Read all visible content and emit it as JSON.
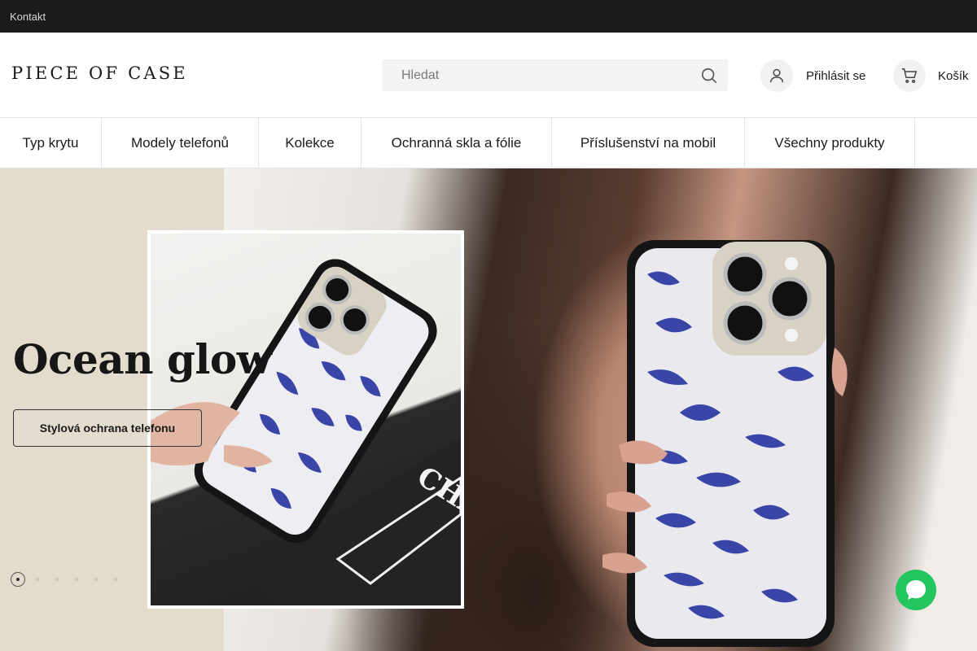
{
  "topbar": {
    "contact_link": "Kontakt"
  },
  "header": {
    "logo_text": "PIECE OF CASE",
    "search": {
      "placeholder": "Hledat",
      "value": ""
    },
    "login_label": "Přihlásit se",
    "cart_label": "Košík"
  },
  "nav": {
    "items": [
      {
        "label": "Typ krytu"
      },
      {
        "label": "Modely telefonů"
      },
      {
        "label": "Kolekce"
      },
      {
        "label": "Ochranná skla a fólie"
      },
      {
        "label": "Příslušenství na mobil"
      },
      {
        "label": "Všechny produkty"
      }
    ]
  },
  "hero": {
    "title": "Ocean glow",
    "cta_label": "Stylová ochrana telefonu",
    "slides_count": 6,
    "active_slide": 1
  },
  "colors": {
    "topbar_bg": "#1b1b1b",
    "hero_bg": "#e3dccd",
    "chat_accent": "#22c55e",
    "case_pattern": "#3a45a8"
  },
  "icons": [
    "search-icon",
    "user-icon",
    "cart-icon",
    "chat-icon"
  ]
}
